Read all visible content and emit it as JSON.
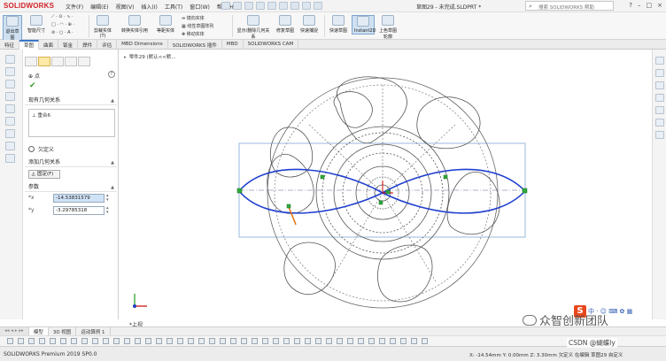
{
  "app": {
    "brand": "SOLIDWORKS",
    "document_title": "草图29 - 未完成.SLDPRT *",
    "menu": [
      "文件(F)",
      "编辑(E)",
      "视图(V)",
      "插入(I)",
      "工具(T)",
      "窗口(W)",
      "帮助(H)"
    ],
    "search_placeholder": "搜索 SOLIDWORKS 帮助",
    "window_controls": [
      "?",
      "–",
      "□",
      "×"
    ]
  },
  "ribbon": {
    "exit_sketch": "退出草图",
    "smart_dim": "智能尺寸",
    "trim": "剪裁实体(T)",
    "convert": "转换实体引用",
    "offset": "等距实体",
    "mirror": "镜向实体",
    "linear_pattern": "线性草图阵列",
    "move": "移动实体",
    "show_relations": "显示/删除几何关系",
    "repair": "修复草图",
    "quick_snap": "快速捕捉",
    "rapid_sketch": "快速草图",
    "instant2d": "Instant2D",
    "shaded_sketch": "上色草图轮廓"
  },
  "tabs": [
    "特征",
    "草图",
    "曲面",
    "钣金",
    "焊件",
    "评估",
    "MBD Dimensions",
    "SOLIDWORKS 插件",
    "MBD",
    "SOLIDWORKS CAM"
  ],
  "active_tab": "草图",
  "property_manager": {
    "title": "点",
    "existing_relations_title": "现有几何关系",
    "relation_item": "重合6",
    "under_defined": "欠定义",
    "add_relations_title": "添加几何关系",
    "fix_button": "固定(F)",
    "parameters_title": "参数",
    "param_x_value": "-14.53831579",
    "param_y_value": "-3.29785318",
    "param_x_label": "*x",
    "param_y_label": "*y"
  },
  "graphics": {
    "feature_tree_crumb": "零件29 (默认<<默...",
    "view_label": "*上视"
  },
  "bottom_tabs": [
    "模型",
    "3D 视图",
    "运动算例 1"
  ],
  "status": {
    "product": "SOLIDWORKS Premium 2019 SP0.0",
    "coordinates": "X: -14.54mm Y: 0.00mm Z: 3.30mm   欠定义   在编辑 草图29   自定义"
  },
  "watermark": {
    "channel": "众智创新团队",
    "csdn": "CSDN @蝴蝶ly"
  },
  "colors": {
    "accent": "#3b78c4",
    "curve_blue": "#1f3fd0",
    "selection_green": "#2eaa3c",
    "orange_segment": "#e07a1a",
    "logo_red": "#d2232a"
  }
}
